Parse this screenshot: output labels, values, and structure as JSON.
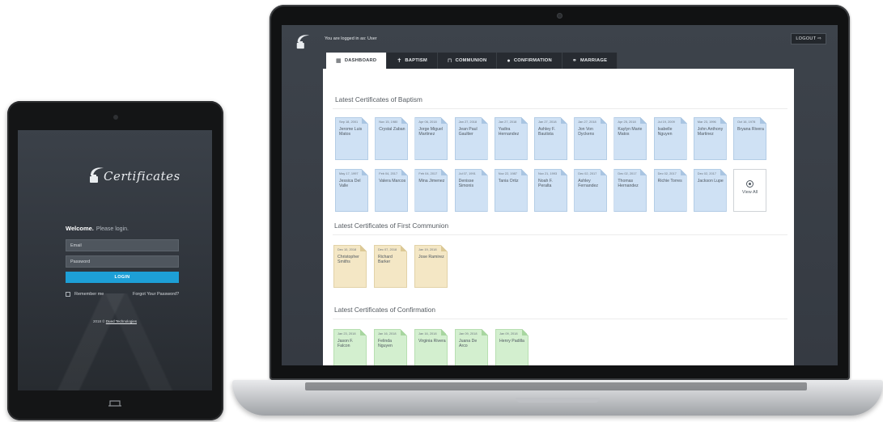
{
  "tablet": {
    "brand": "Certificates",
    "welcome": "Welcome.",
    "please_login": "Please login.",
    "email_placeholder": "Email",
    "password_placeholder": "Password",
    "login_label": "LOGIN",
    "remember_label": "Remember me",
    "forgot_label": "Forgot Your Password?",
    "footer_text": "2018 ©",
    "footer_link": "Dued Technologies"
  },
  "header": {
    "logged_in_text": "You are logged in as: User",
    "logout_label": "LOGOUT ⇨"
  },
  "tabs": [
    {
      "label": "DASHBOARD",
      "icon": "grid-icon",
      "glyph": "▦"
    },
    {
      "label": "BAPTISM",
      "icon": "cross-icon",
      "glyph": "✝"
    },
    {
      "label": "COMMUNION",
      "icon": "book-icon",
      "glyph": "⊓"
    },
    {
      "label": "CONFIRMATION",
      "icon": "circle-icon",
      "glyph": "●"
    },
    {
      "label": "MARRIAGE",
      "icon": "rings-icon",
      "glyph": "⚭"
    }
  ],
  "sections": {
    "baptism": {
      "title": "Latest Certificates of Baptism",
      "row1": [
        {
          "date": "Sep 18, 2001",
          "name": "Jerome Luis Matos"
        },
        {
          "date": "Nov 15, 1980",
          "name": "Crystal Zaban"
        },
        {
          "date": "Apr 06, 2018",
          "name": "Jorge Miguel Martinez"
        },
        {
          "date": "Jan 27, 2018",
          "name": "Jean Paul Gaultier"
        },
        {
          "date": "Jan 27, 2018",
          "name": "Yadira Hernandez"
        },
        {
          "date": "Jan 27, 2018",
          "name": "Ashley F. Bautista"
        },
        {
          "date": "Jan 27, 2018",
          "name": "Jon Von Dyckens"
        },
        {
          "date": "Apr 25, 2018",
          "name": "Kaylyn Marie Matos"
        },
        {
          "date": "Jul 19, 2009",
          "name": "Isabelle Nguyen"
        },
        {
          "date": "Mar 23, 1996",
          "name": "John Anthony Martinez"
        },
        {
          "date": "Oct 16, 1978",
          "name": "Bryana Rivera"
        }
      ],
      "row2": [
        {
          "date": "May 17, 1997",
          "name": "Jessica Del Valle"
        },
        {
          "date": "Feb 04, 2017",
          "name": "Valera Marcos"
        },
        {
          "date": "Feb 04, 2017",
          "name": "Mina Jimenez"
        },
        {
          "date": "Jul 07, 1991",
          "name": "Denisse Simonis"
        },
        {
          "date": "Nov 22, 1987",
          "name": "Tania Ortiz"
        },
        {
          "date": "Nov 21, 1993",
          "name": "Noah F. Peralta"
        },
        {
          "date": "Dec 02, 2017",
          "name": "Ashley Fernandez"
        },
        {
          "date": "Dec 02, 2017",
          "name": "Thomas Hernandez"
        },
        {
          "date": "Dec 02, 2017",
          "name": "Richie Torres"
        },
        {
          "date": "Dec 02, 2017",
          "name": "Jackson Lupe"
        }
      ],
      "view_all": "View All"
    },
    "communion": {
      "title": "Latest Certificates of First Communion",
      "items": [
        {
          "date": "Dec 10, 2018",
          "name": "Christopher Smiths"
        },
        {
          "date": "Dec 07, 2018",
          "name": "Richard Barker"
        },
        {
          "date": "Jan 19, 2018",
          "name": "Jose Ramirez"
        }
      ]
    },
    "confirmation": {
      "title": "Latest Certificates of Confirmation",
      "items": [
        {
          "date": "Jan 23, 2018",
          "name": "Jason F. Falcon"
        },
        {
          "date": "Jan 16, 2018",
          "name": "Felinda Nguyen"
        },
        {
          "date": "Jan 16, 2018",
          "name": "Virginia Rivera"
        },
        {
          "date": "Jan 09, 2018",
          "name": "Juana De Arco"
        },
        {
          "date": "Jan 09, 2018",
          "name": "Henry Padilla"
        }
      ]
    }
  },
  "colors": {
    "accent": "#1d9fd6",
    "baptism_card": "#cfe1f4",
    "communion_card": "#f4e7c5",
    "confirmation_card": "#d3efcf",
    "tab_bar": "#272b31"
  }
}
